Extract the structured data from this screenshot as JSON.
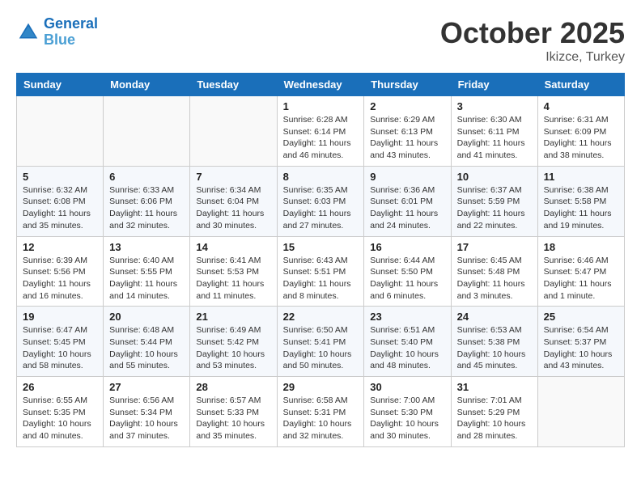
{
  "header": {
    "logo_line1": "General",
    "logo_line2": "Blue",
    "month_title": "October 2025",
    "location": "Ikizce, Turkey"
  },
  "weekdays": [
    "Sunday",
    "Monday",
    "Tuesday",
    "Wednesday",
    "Thursday",
    "Friday",
    "Saturday"
  ],
  "weeks": [
    [
      {
        "day": "",
        "info": ""
      },
      {
        "day": "",
        "info": ""
      },
      {
        "day": "",
        "info": ""
      },
      {
        "day": "1",
        "info": "Sunrise: 6:28 AM\nSunset: 6:14 PM\nDaylight: 11 hours\nand 46 minutes."
      },
      {
        "day": "2",
        "info": "Sunrise: 6:29 AM\nSunset: 6:13 PM\nDaylight: 11 hours\nand 43 minutes."
      },
      {
        "day": "3",
        "info": "Sunrise: 6:30 AM\nSunset: 6:11 PM\nDaylight: 11 hours\nand 41 minutes."
      },
      {
        "day": "4",
        "info": "Sunrise: 6:31 AM\nSunset: 6:09 PM\nDaylight: 11 hours\nand 38 minutes."
      }
    ],
    [
      {
        "day": "5",
        "info": "Sunrise: 6:32 AM\nSunset: 6:08 PM\nDaylight: 11 hours\nand 35 minutes."
      },
      {
        "day": "6",
        "info": "Sunrise: 6:33 AM\nSunset: 6:06 PM\nDaylight: 11 hours\nand 32 minutes."
      },
      {
        "day": "7",
        "info": "Sunrise: 6:34 AM\nSunset: 6:04 PM\nDaylight: 11 hours\nand 30 minutes."
      },
      {
        "day": "8",
        "info": "Sunrise: 6:35 AM\nSunset: 6:03 PM\nDaylight: 11 hours\nand 27 minutes."
      },
      {
        "day": "9",
        "info": "Sunrise: 6:36 AM\nSunset: 6:01 PM\nDaylight: 11 hours\nand 24 minutes."
      },
      {
        "day": "10",
        "info": "Sunrise: 6:37 AM\nSunset: 5:59 PM\nDaylight: 11 hours\nand 22 minutes."
      },
      {
        "day": "11",
        "info": "Sunrise: 6:38 AM\nSunset: 5:58 PM\nDaylight: 11 hours\nand 19 minutes."
      }
    ],
    [
      {
        "day": "12",
        "info": "Sunrise: 6:39 AM\nSunset: 5:56 PM\nDaylight: 11 hours\nand 16 minutes."
      },
      {
        "day": "13",
        "info": "Sunrise: 6:40 AM\nSunset: 5:55 PM\nDaylight: 11 hours\nand 14 minutes."
      },
      {
        "day": "14",
        "info": "Sunrise: 6:41 AM\nSunset: 5:53 PM\nDaylight: 11 hours\nand 11 minutes."
      },
      {
        "day": "15",
        "info": "Sunrise: 6:43 AM\nSunset: 5:51 PM\nDaylight: 11 hours\nand 8 minutes."
      },
      {
        "day": "16",
        "info": "Sunrise: 6:44 AM\nSunset: 5:50 PM\nDaylight: 11 hours\nand 6 minutes."
      },
      {
        "day": "17",
        "info": "Sunrise: 6:45 AM\nSunset: 5:48 PM\nDaylight: 11 hours\nand 3 minutes."
      },
      {
        "day": "18",
        "info": "Sunrise: 6:46 AM\nSunset: 5:47 PM\nDaylight: 11 hours\nand 1 minute."
      }
    ],
    [
      {
        "day": "19",
        "info": "Sunrise: 6:47 AM\nSunset: 5:45 PM\nDaylight: 10 hours\nand 58 minutes."
      },
      {
        "day": "20",
        "info": "Sunrise: 6:48 AM\nSunset: 5:44 PM\nDaylight: 10 hours\nand 55 minutes."
      },
      {
        "day": "21",
        "info": "Sunrise: 6:49 AM\nSunset: 5:42 PM\nDaylight: 10 hours\nand 53 minutes."
      },
      {
        "day": "22",
        "info": "Sunrise: 6:50 AM\nSunset: 5:41 PM\nDaylight: 10 hours\nand 50 minutes."
      },
      {
        "day": "23",
        "info": "Sunrise: 6:51 AM\nSunset: 5:40 PM\nDaylight: 10 hours\nand 48 minutes."
      },
      {
        "day": "24",
        "info": "Sunrise: 6:53 AM\nSunset: 5:38 PM\nDaylight: 10 hours\nand 45 minutes."
      },
      {
        "day": "25",
        "info": "Sunrise: 6:54 AM\nSunset: 5:37 PM\nDaylight: 10 hours\nand 43 minutes."
      }
    ],
    [
      {
        "day": "26",
        "info": "Sunrise: 6:55 AM\nSunset: 5:35 PM\nDaylight: 10 hours\nand 40 minutes."
      },
      {
        "day": "27",
        "info": "Sunrise: 6:56 AM\nSunset: 5:34 PM\nDaylight: 10 hours\nand 37 minutes."
      },
      {
        "day": "28",
        "info": "Sunrise: 6:57 AM\nSunset: 5:33 PM\nDaylight: 10 hours\nand 35 minutes."
      },
      {
        "day": "29",
        "info": "Sunrise: 6:58 AM\nSunset: 5:31 PM\nDaylight: 10 hours\nand 32 minutes."
      },
      {
        "day": "30",
        "info": "Sunrise: 7:00 AM\nSunset: 5:30 PM\nDaylight: 10 hours\nand 30 minutes."
      },
      {
        "day": "31",
        "info": "Sunrise: 7:01 AM\nSunset: 5:29 PM\nDaylight: 10 hours\nand 28 minutes."
      },
      {
        "day": "",
        "info": ""
      }
    ]
  ]
}
